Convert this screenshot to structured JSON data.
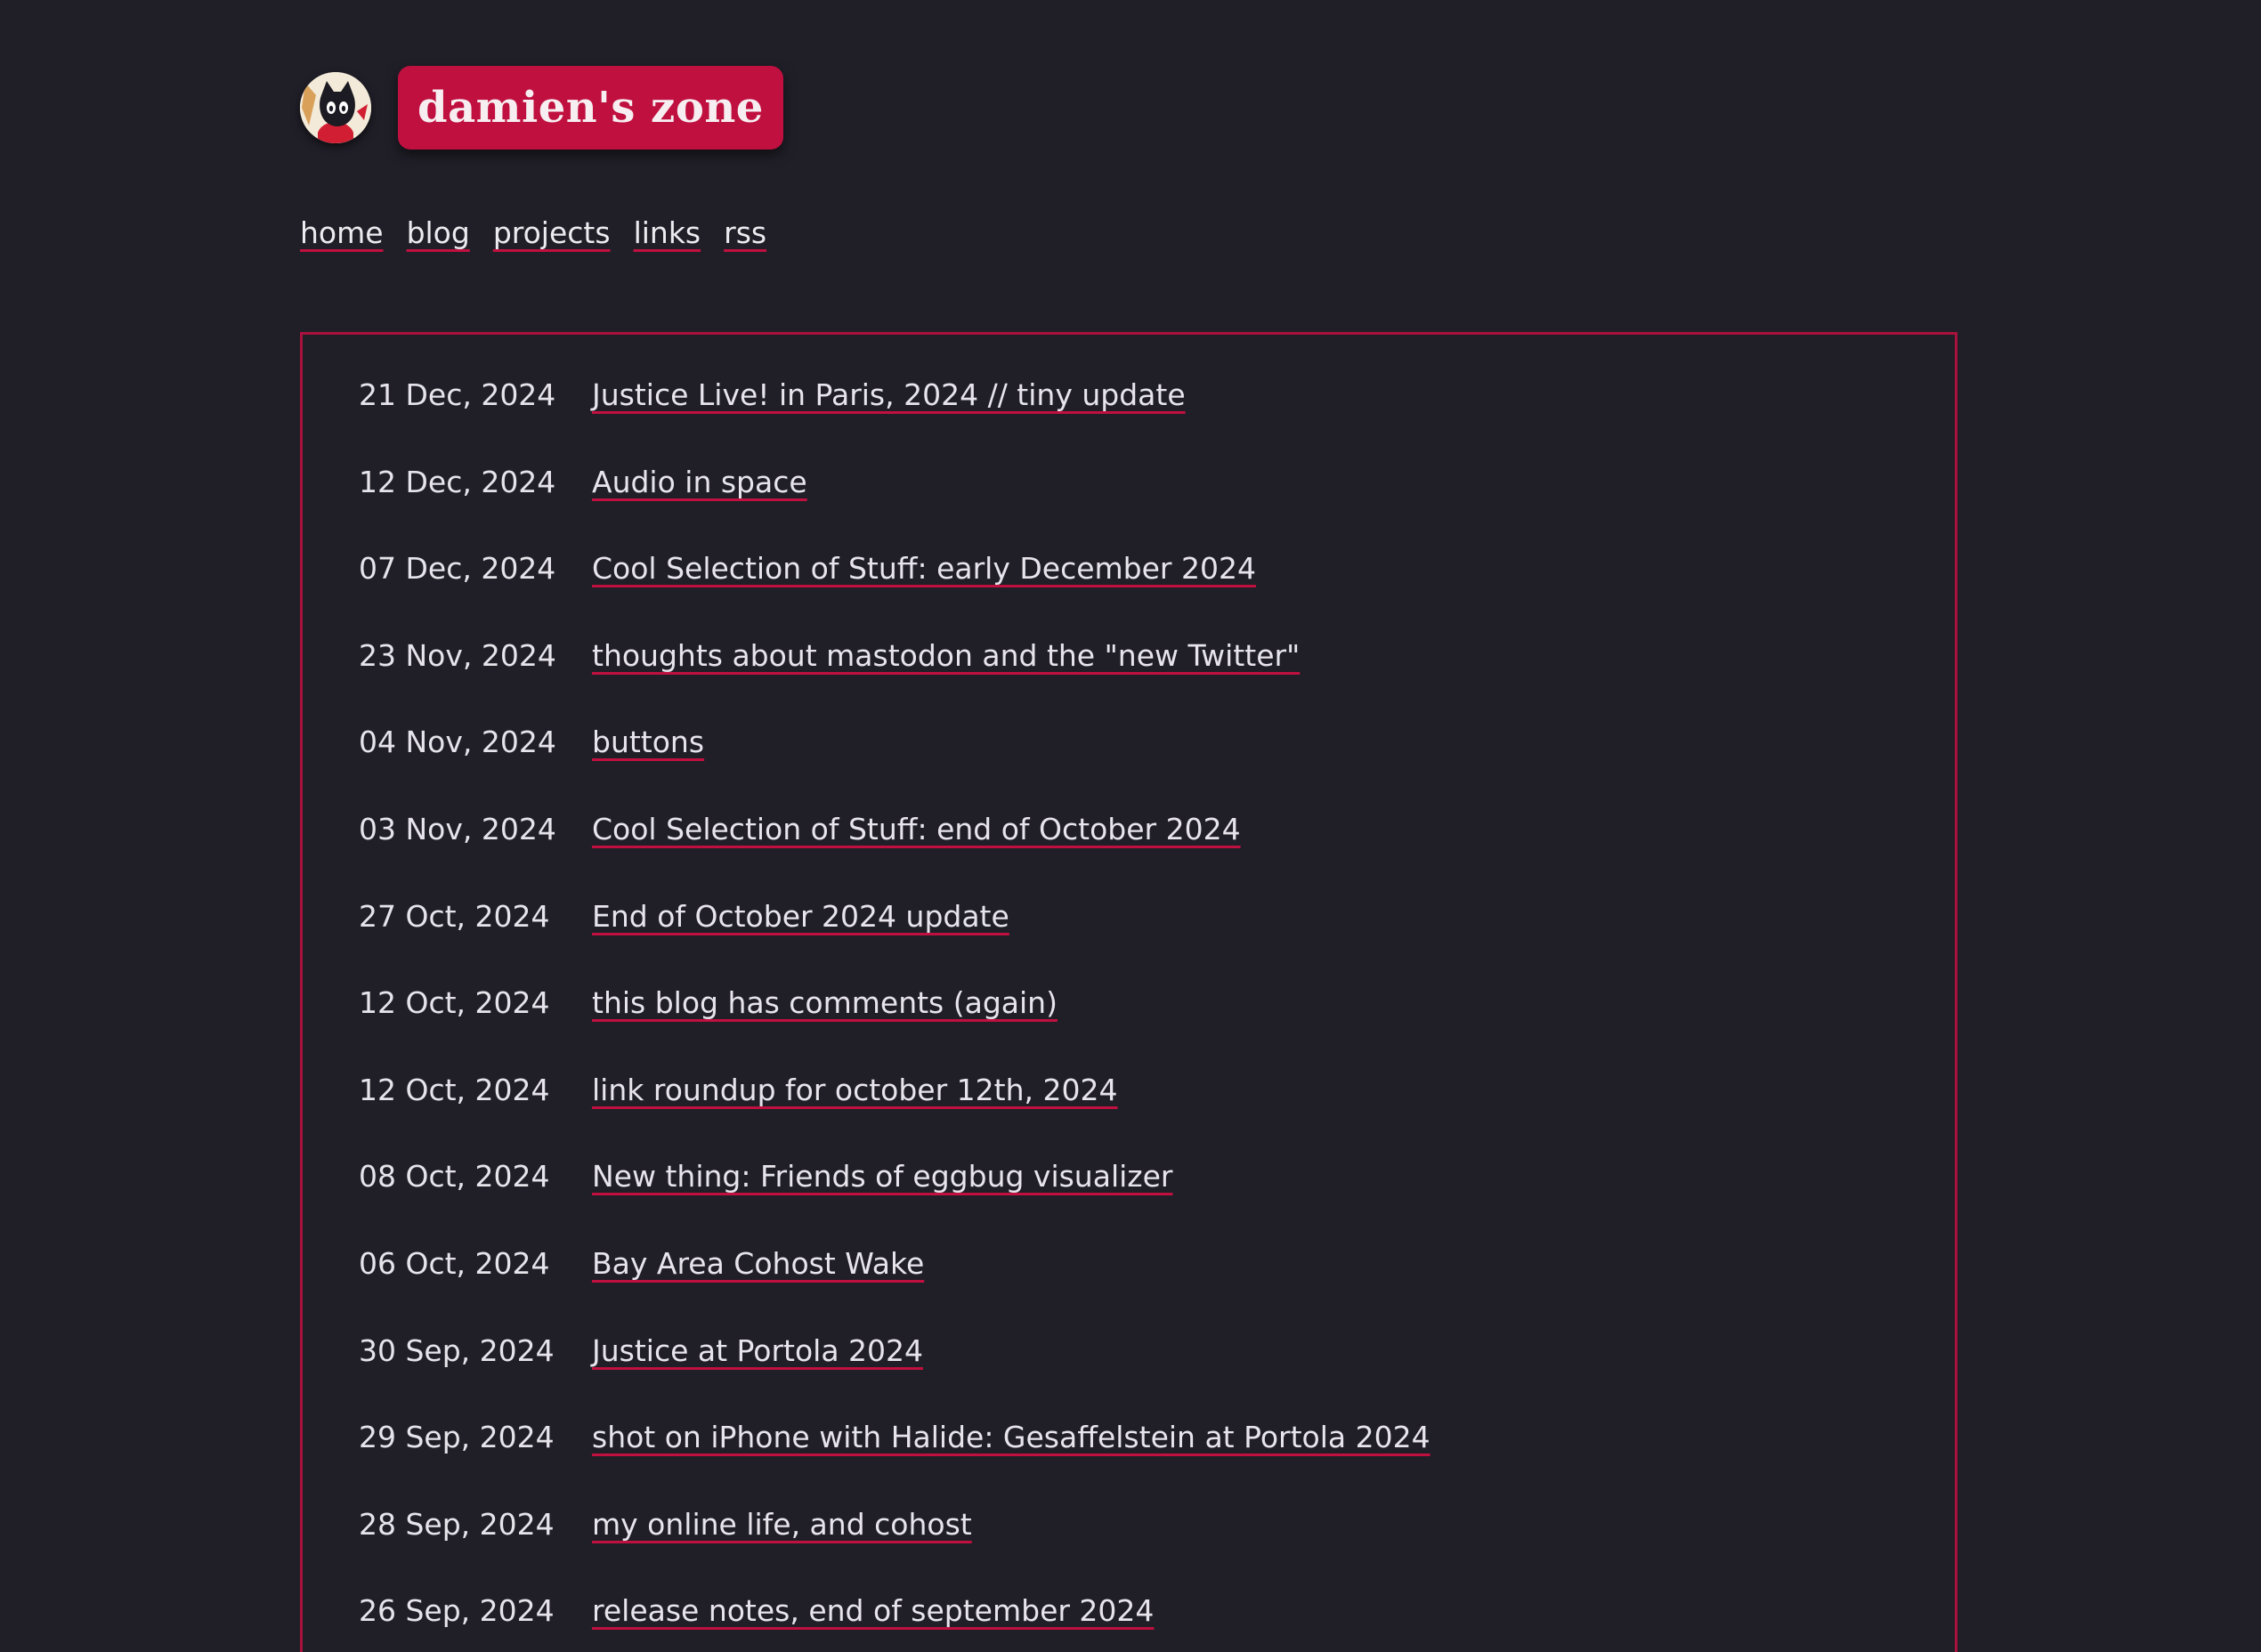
{
  "site": {
    "title": "damien's zone",
    "avatar_icon": "cat-avatar-icon",
    "accent_color": "#c0103f",
    "background_color": "#201f28"
  },
  "nav": {
    "items": [
      {
        "label": "home"
      },
      {
        "label": "blog"
      },
      {
        "label": "projects"
      },
      {
        "label": "links"
      },
      {
        "label": "rss"
      }
    ]
  },
  "posts": [
    {
      "date": "21 Dec, 2024",
      "title": "Justice Live! in Paris, 2024 // tiny update"
    },
    {
      "date": "12 Dec, 2024",
      "title": "Audio in space"
    },
    {
      "date": "07 Dec, 2024",
      "title": "Cool Selection of Stuff: early December 2024"
    },
    {
      "date": "23 Nov, 2024",
      "title": "thoughts about mastodon and the \"new Twitter\""
    },
    {
      "date": "04 Nov, 2024",
      "title": "buttons"
    },
    {
      "date": "03 Nov, 2024",
      "title": "Cool Selection of Stuff: end of October 2024"
    },
    {
      "date": "27 Oct, 2024",
      "title": "End of October 2024 update"
    },
    {
      "date": "12 Oct, 2024",
      "title": "this blog has comments (again)"
    },
    {
      "date": "12 Oct, 2024",
      "title": "link roundup for october 12th, 2024"
    },
    {
      "date": "08 Oct, 2024",
      "title": "New thing: Friends of eggbug visualizer"
    },
    {
      "date": "06 Oct, 2024",
      "title": "Bay Area Cohost Wake"
    },
    {
      "date": "30 Sep, 2024",
      "title": "Justice at Portola 2024"
    },
    {
      "date": "29 Sep, 2024",
      "title": "shot on iPhone with Halide: Gesaffelstein at Portola 2024"
    },
    {
      "date": "28 Sep, 2024",
      "title": "my online life, and cohost"
    },
    {
      "date": "26 Sep, 2024",
      "title": "release notes, end of september 2024"
    }
  ]
}
